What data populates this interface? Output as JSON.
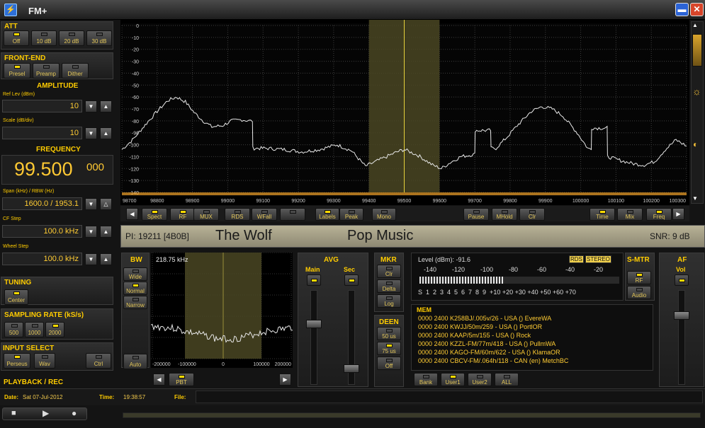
{
  "app": {
    "title": "FM+"
  },
  "left": {
    "att": {
      "label": "ATT",
      "buttons": [
        {
          "label": "Off",
          "on": true
        },
        {
          "label": "10 dB",
          "on": false
        },
        {
          "label": "20 dB",
          "on": false
        },
        {
          "label": "30 dB",
          "on": false
        }
      ]
    },
    "frontend": {
      "label": "FRONT-END",
      "buttons": [
        {
          "label": "Presel",
          "on": true
        },
        {
          "label": "Preamp",
          "on": false
        },
        {
          "label": "Dither",
          "on": false
        }
      ]
    },
    "amplitude": {
      "label": "AMPLITUDE",
      "ref_label": "Ref Lev (dBm)",
      "ref_value": "10",
      "scale_label": "Scale (dB/div)",
      "scale_value": "10"
    },
    "frequency": {
      "label": "FREQUENCY",
      "main": "99.500",
      "fine": "000",
      "span_label": "Span (kHz) / RBW (Hz)",
      "span_value": "1600.0 / 1953.1",
      "cf_label": "CF Step",
      "cf_value": "100.0 kHz",
      "wheel_label": "Wheel Step",
      "wheel_value": "100.0 kHz"
    },
    "tuning": {
      "label": "TUNING",
      "button": "Center"
    },
    "sampling": {
      "label": "SAMPLING RATE (kS/s)",
      "buttons": [
        {
          "label": "500",
          "on": false
        },
        {
          "label": "1000",
          "on": false
        },
        {
          "label": "2000",
          "on": true
        }
      ]
    },
    "input": {
      "label": "INPUT SELECT",
      "buttons": [
        {
          "label": "Perseus",
          "on": true
        },
        {
          "label": "Wav",
          "on": false
        },
        {
          "label": "Ctrl",
          "on": false
        }
      ]
    },
    "playback": {
      "label": "PLAYBACK / REC"
    }
  },
  "spectrum": {
    "y_ticks": [
      "0",
      "-10",
      "-20",
      "-30",
      "-40",
      "-50",
      "-60",
      "-70",
      "-80",
      "-90",
      "-100",
      "-110",
      "-120",
      "-130",
      "-140"
    ],
    "x_ticks": [
      "98700",
      "98800",
      "98900",
      "99000",
      "99100",
      "99200",
      "99300",
      "99400",
      "99500",
      "99600",
      "99700",
      "99800",
      "99900",
      "100000",
      "100100",
      "100200",
      "100300"
    ],
    "xlim": [
      98700,
      100300
    ],
    "ylim": [
      -140,
      0
    ],
    "trace": [
      [
        98700,
        -104
      ],
      [
        98730,
        -96
      ],
      [
        98770,
        -82
      ],
      [
        98800,
        -72
      ],
      [
        98830,
        -63
      ],
      [
        98855,
        -60
      ],
      [
        98880,
        -64
      ],
      [
        98905,
        -73
      ],
      [
        98930,
        -80
      ],
      [
        98955,
        -85
      ],
      [
        98985,
        -84
      ],
      [
        99010,
        -80
      ],
      [
        99040,
        -79
      ],
      [
        99060,
        -80
      ],
      [
        99070,
        -80
      ],
      [
        99071,
        -103
      ],
      [
        99110,
        -103
      ],
      [
        99160,
        -104
      ],
      [
        99210,
        -106
      ],
      [
        99260,
        -104
      ],
      [
        99310,
        -100
      ],
      [
        99350,
        -105
      ],
      [
        99390,
        -118
      ],
      [
        99420,
        -114
      ],
      [
        99450,
        -110
      ],
      [
        99480,
        -106
      ],
      [
        99500,
        -104
      ],
      [
        99540,
        -109
      ],
      [
        99580,
        -117
      ],
      [
        99605,
        -120
      ],
      [
        99630,
        -115
      ],
      [
        99660,
        -110
      ],
      [
        99700,
        -108
      ],
      [
        99701,
        -88
      ],
      [
        99730,
        -88
      ],
      [
        99745,
        -88
      ],
      [
        99746,
        -103
      ],
      [
        99760,
        -103
      ],
      [
        99790,
        -94
      ],
      [
        99820,
        -84
      ],
      [
        99860,
        -72
      ],
      [
        99890,
        -68
      ],
      [
        99920,
        -70
      ],
      [
        99950,
        -76
      ],
      [
        99990,
        -90
      ],
      [
        100020,
        -103
      ],
      [
        100030,
        -104
      ],
      [
        100031,
        -86
      ],
      [
        100060,
        -86
      ],
      [
        100075,
        -86
      ],
      [
        100076,
        -110
      ],
      [
        100110,
        -113
      ],
      [
        100150,
        -116
      ],
      [
        100180,
        -117
      ],
      [
        100210,
        -114
      ],
      [
        100240,
        -104
      ],
      [
        100270,
        -96
      ],
      [
        100300,
        -101
      ]
    ]
  },
  "toolbar": [
    {
      "label": "Spect",
      "on": true
    },
    {
      "label": "RF",
      "on": true
    },
    {
      "label": "MUX",
      "on": false
    },
    {
      "label": "RDS",
      "on": false
    },
    {
      "label": "WFall",
      "on": false
    },
    {
      "label": "Labels",
      "on": true
    },
    {
      "label": "Peak",
      "on": false
    },
    {
      "label": "Mono",
      "on": false
    },
    {
      "label": "Pause",
      "on": false
    },
    {
      "label": "MHold",
      "on": false
    },
    {
      "label": "Clr",
      "on": false
    },
    {
      "label": "Time",
      "on": true
    },
    {
      "label": "Mix",
      "on": false
    },
    {
      "label": "Freq",
      "on": true
    }
  ],
  "rds": {
    "pi": "PI: 19211 [4B0B]",
    "ps": "The Wolf",
    "pty": "Pop Music",
    "snr": "SNR:  9 dB"
  },
  "bw": {
    "label": "BW",
    "buttons": [
      {
        "label": "Wide",
        "on": false
      },
      {
        "label": "Normal",
        "on": true
      },
      {
        "label": "Narrow",
        "on": false
      }
    ],
    "auto": "Auto",
    "pbt": "PBT"
  },
  "narrow": {
    "bw_readout": "218.75 kHz",
    "x_ticks": [
      "-200000",
      "-100000",
      "0",
      "100000",
      "200000"
    ]
  },
  "avg": {
    "label": "AVG",
    "main": "Main",
    "sec": "Sec"
  },
  "mkr": {
    "label": "MKR",
    "buttons": [
      "Clr",
      "Delta",
      "Log"
    ]
  },
  "deen": {
    "label": "DEEN",
    "buttons": [
      {
        "label": "50 us",
        "on": false
      },
      {
        "label": "75 us",
        "on": true
      },
      {
        "label": "Off",
        "on": false
      }
    ]
  },
  "level": {
    "text": "Level (dBm):  -91.6",
    "rds_badge": "RDS",
    "stereo_badge": "STEREO",
    "top_scale": [
      "-140",
      "-120",
      "-100",
      "-80",
      "-60",
      "-40",
      "-20"
    ],
    "bottom_scale": "S  1  2  3  4  5  6  7  8  9  +10 +20 +30 +40 +50 +60 +70",
    "bar_fraction": 0.42
  },
  "smtr": {
    "label": "S-MTR",
    "buttons": [
      {
        "label": "RF",
        "on": true
      },
      {
        "label": "Audio",
        "on": false
      }
    ]
  },
  "af": {
    "label": "AF",
    "vol": "Vol"
  },
  "mem": {
    "label": "MEM",
    "lines": [
      "0000 2400 K258BJ/.005v/26  - USA ()  EvereWA",
      "0000 2400 KWJJ/50m/259  - USA ()  PortlOR",
      "0000 2400 KAAP/5m/155  - USA ()  Rock",
      "0000 2400 KZZL-FM/77m/418  - USA ()  PullmWA",
      "0000 2400 KAGO-FM/60m/622  - USA ()  KlamaOR",
      "0000 2400 CBCV-FM/.064h/118  - CAN (en)  MetchBC"
    ],
    "buttons": [
      {
        "label": "Bank",
        "on": false
      },
      {
        "label": "User1",
        "on": true
      },
      {
        "label": "User2",
        "on": false
      },
      {
        "label": "ALL",
        "on": false
      }
    ]
  },
  "status": {
    "date_label": "Date:",
    "date": "Sat 07-Jul-2012",
    "time_label": "Time:",
    "time": "19:38:57",
    "file_label": "File:"
  }
}
